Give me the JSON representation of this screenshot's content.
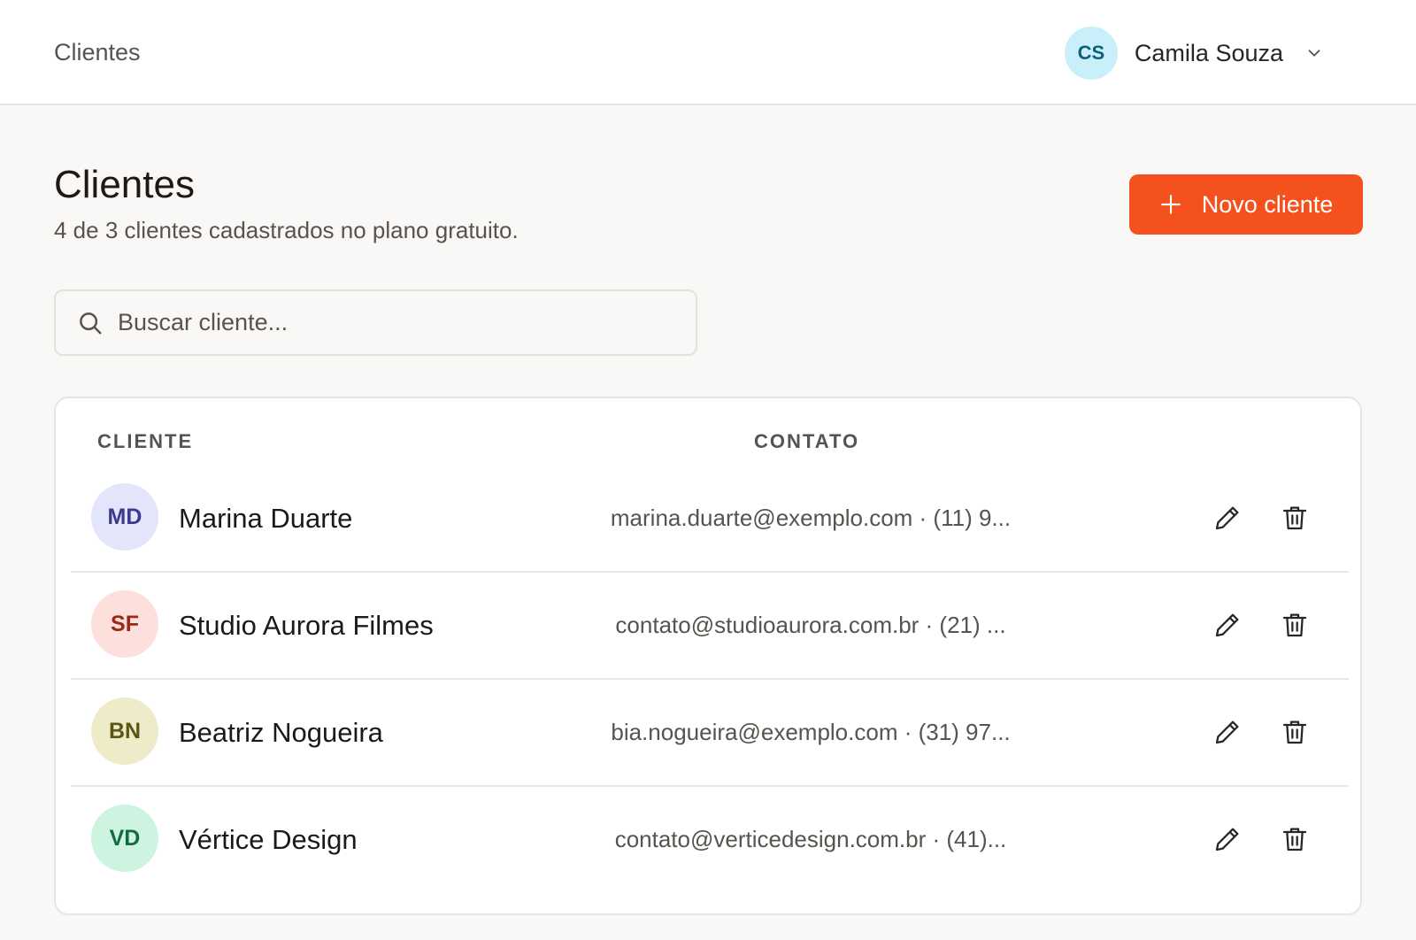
{
  "topbar": {
    "title": "Clientes",
    "user": {
      "initials": "CS",
      "name": "Camila Souza"
    }
  },
  "header": {
    "title": "Clientes",
    "subtitle": "4 de 3 clientes cadastrados no plano gratuito.",
    "new_button": "Novo cliente"
  },
  "search": {
    "placeholder": "Buscar cliente..."
  },
  "table": {
    "columns": {
      "client": "CLIENTE",
      "contact": "CONTATO"
    },
    "rows": [
      {
        "initials": "MD",
        "name": "Marina Duarte",
        "contact": "marina.duarte@exemplo.com · (11) 9...",
        "avatar_bg": "#e3e5fb",
        "avatar_fg": "#3d3a8c"
      },
      {
        "initials": "SF",
        "name": "Studio Aurora Filmes",
        "contact": "contato@studioaurora.com.br · (21) ...",
        "avatar_bg": "#fde0db",
        "avatar_fg": "#9a2a14"
      },
      {
        "initials": "BN",
        "name": "Beatriz Nogueira",
        "contact": "bia.nogueira@exemplo.com · (31) 97...",
        "avatar_bg": "#eeecc8",
        "avatar_fg": "#5e5414"
      },
      {
        "initials": "VD",
        "name": "Vértice Design",
        "contact": "contato@verticedesign.com.br · (41)...",
        "avatar_bg": "#cdf3e1",
        "avatar_fg": "#15693f"
      }
    ]
  },
  "colors": {
    "accent": "#f4511e",
    "user_avatar_bg": "#c9f0fa"
  }
}
